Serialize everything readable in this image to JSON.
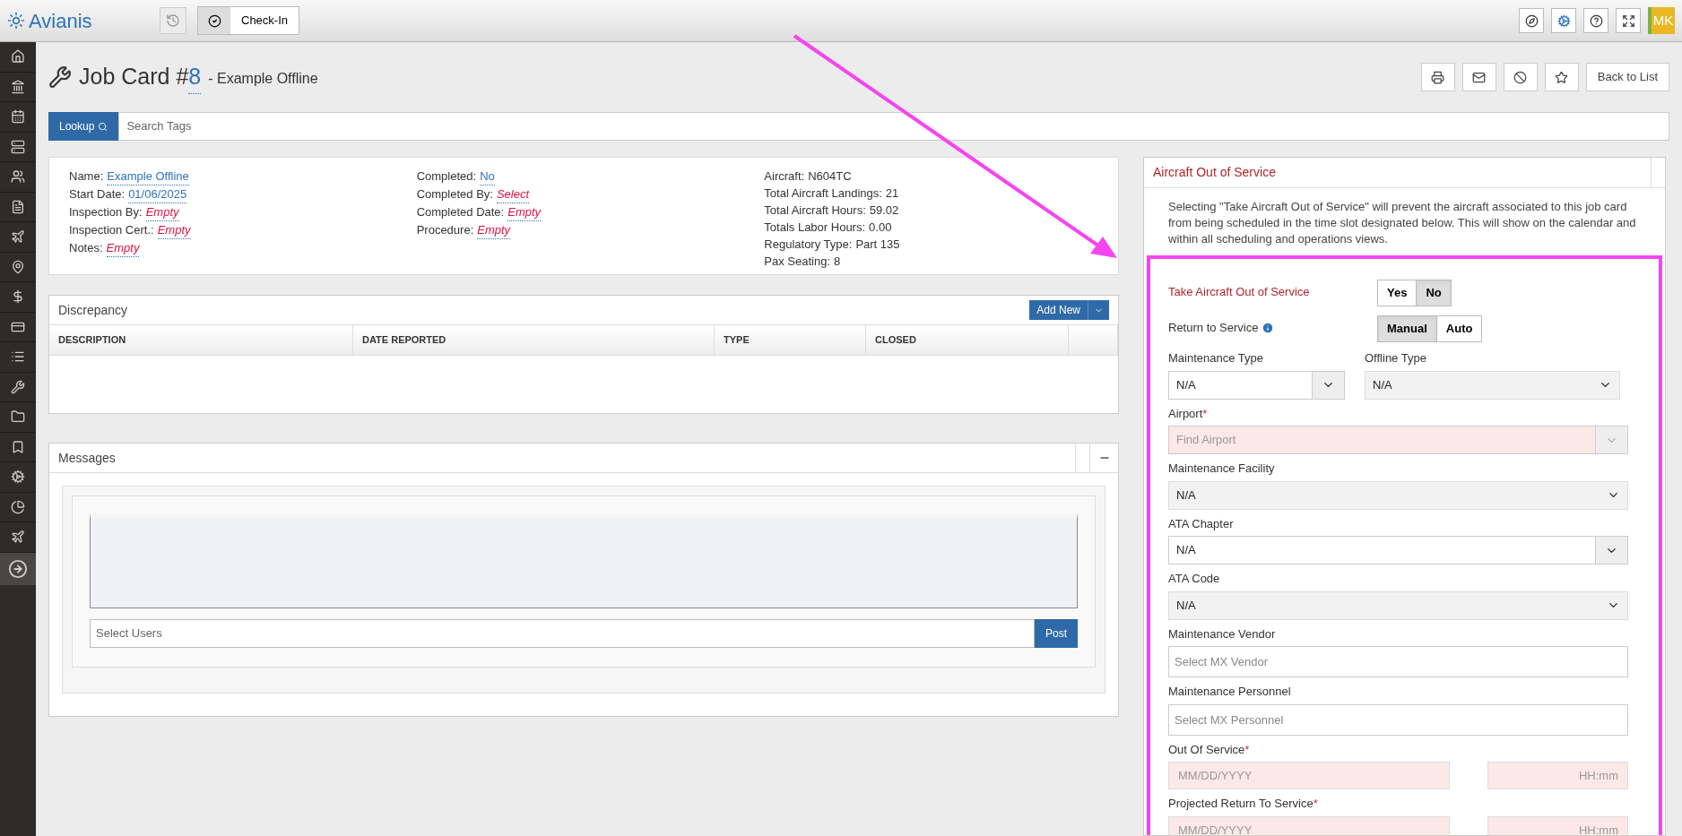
{
  "topbar": {
    "logo": "Avianis",
    "checkin_button": "Check-In",
    "user_initials": "MK"
  },
  "page": {
    "title": "Job Card #",
    "number": "8",
    "subtitle": "- Example Offline",
    "back_button": "Back to List"
  },
  "search": {
    "button": "Lookup",
    "placeholder": "Search Tags"
  },
  "details": [
    [
      {
        "label": "Name:",
        "value": "Example Offline",
        "kind": "link"
      },
      {
        "label": "Start Date:",
        "value": "01/06/2025",
        "kind": "link"
      },
      {
        "label": "Inspection By:",
        "value": "Empty",
        "kind": "empty"
      },
      {
        "label": "Inspection Cert.:",
        "value": "Empty",
        "kind": "empty"
      },
      {
        "label": "Notes:",
        "value": "Empty",
        "kind": "empty"
      }
    ],
    [
      {
        "label": "Completed:",
        "value": "No",
        "kind": "link"
      },
      {
        "label": "Completed By:",
        "value": "Select",
        "kind": "empty"
      },
      {
        "label": "Completed Date:",
        "value": "Empty",
        "kind": "empty"
      },
      {
        "label": "Procedure:",
        "value": "Empty",
        "kind": "empty"
      }
    ],
    [
      {
        "label": "Aircraft:",
        "value": "N604TC",
        "kind": "plain"
      },
      {
        "label": "Total Aircraft Landings:",
        "value": "21",
        "kind": "plain"
      },
      {
        "label": "Total Aircraft Hours:",
        "value": "59.02",
        "kind": "plain"
      },
      {
        "label": "Totals Labor Hours:",
        "value": "0.00",
        "kind": "plain"
      },
      {
        "label": "Regulatory Type:",
        "value": "Part 135",
        "kind": "plain"
      },
      {
        "label": "Pax Seating:",
        "value": "8",
        "kind": "plain"
      }
    ]
  ],
  "discrepancy": {
    "title": "Discrepancy",
    "add_button": "Add New",
    "columns": [
      "DESCRIPTION",
      "DATE REPORTED",
      "TYPE",
      "CLOSED"
    ]
  },
  "messages": {
    "title": "Messages",
    "users_placeholder": "Select Users",
    "post_button": "Post"
  },
  "out_of_service": {
    "title": "Aircraft Out of Service",
    "description": "Selecting \"Take Aircraft Out of Service\" will prevent the aircraft associated to this job card from being scheduled in the time slot designated below. This will show on the calendar and within all scheduling and operations views.",
    "toggles": [
      {
        "label": "Take Aircraft Out of Service",
        "info": false,
        "options": [
          {
            "label": "Yes",
            "selected": false
          },
          {
            "label": "No",
            "selected": true
          }
        ]
      },
      {
        "label": "Return to Service",
        "info": true,
        "options": [
          {
            "label": "Manual",
            "selected": true
          },
          {
            "label": "Auto",
            "selected": false
          }
        ]
      }
    ],
    "rows": [
      [
        {
          "kind": "select_addon",
          "label": "Maintenance Type",
          "value": "N/A"
        },
        {
          "kind": "select",
          "label": "Offline Type",
          "value": "N/A"
        }
      ],
      [
        {
          "kind": "lookup",
          "label": "Airport",
          "required_mark": "*",
          "placeholder": "Find Airport"
        }
      ],
      [
        {
          "kind": "select",
          "label": "Maintenance Facility",
          "value": "N/A"
        }
      ],
      [
        {
          "kind": "select_addon",
          "label": "ATA Chapter",
          "value": "N/A"
        }
      ],
      [
        {
          "kind": "select",
          "label": "ATA Code",
          "value": "N/A"
        }
      ],
      [
        {
          "kind": "input",
          "label": "Maintenance Vendor",
          "placeholder": "Select MX Vendor"
        }
      ],
      [
        {
          "kind": "input",
          "label": "Maintenance Personnel",
          "placeholder": "Select MX Personnel"
        }
      ],
      [
        {
          "kind": "datetime",
          "label": "Out Of Service",
          "required_mark": "*",
          "date_placeholder": "MM/DD/YYYY",
          "time_placeholder": "HH:mm"
        }
      ],
      [
        {
          "kind": "datetime",
          "label": "Projected Return To Service",
          "required_mark": "*",
          "date_placeholder": "MM/DD/YYYY",
          "time_placeholder": "HH:mm"
        }
      ]
    ]
  }
}
